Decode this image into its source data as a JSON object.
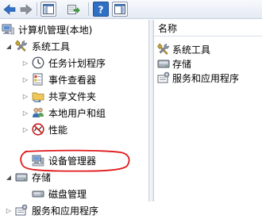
{
  "toolbar": {
    "buttons": [
      {
        "icon": "back-arrow-icon"
      },
      {
        "icon": "forward-arrow-icon"
      },
      {
        "icon": "show-hide-console-tree-icon"
      },
      {
        "icon": "export-list-icon"
      },
      {
        "icon": "help-icon"
      },
      {
        "icon": "show-action-pane-icon"
      }
    ]
  },
  "tree": {
    "root": {
      "label": "计算机管理(本地)",
      "icon": "computer-management-icon"
    },
    "system_tools": {
      "label": "系统工具",
      "icon": "tools-icon",
      "expanded": true
    },
    "items": [
      {
        "label": "任务计划程序",
        "icon": "clock-icon"
      },
      {
        "label": "事件查看器",
        "icon": "event-viewer-icon"
      },
      {
        "label": "共享文件夹",
        "icon": "shared-folder-icon"
      },
      {
        "label": "本地用户和组",
        "icon": "users-icon"
      },
      {
        "label": "性能",
        "icon": "performance-icon"
      },
      {
        "label": "设备管理器",
        "icon": "device-manager-icon"
      }
    ],
    "storage": {
      "label": "存储",
      "icon": "storage-icon",
      "expanded": true
    },
    "disk": {
      "label": "磁盘管理",
      "icon": "disk-icon"
    },
    "services": {
      "label": "服务和应用程序",
      "icon": "services-icon"
    }
  },
  "list": {
    "column_header": "名称",
    "items": [
      {
        "label": "系统工具",
        "icon": "tools-icon"
      },
      {
        "label": "存储",
        "icon": "storage-icon"
      },
      {
        "label": "服务和应用程序",
        "icon": "services-icon"
      }
    ]
  },
  "colors": {
    "highlight": "#e0181b",
    "toolbar_accent": "#2f6fc4"
  }
}
